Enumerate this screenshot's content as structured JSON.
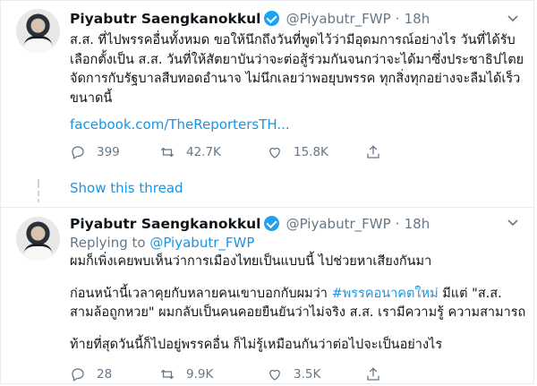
{
  "tweets": [
    {
      "name": "Piyabutr Saengkanokkul",
      "handle": "@Piyabutr_FWP",
      "dot": "·",
      "time": "18h",
      "lines": [
        "ส.ส. ที่ไปพรรคอื่นทั้งหมด ขอให้นึกถึงวันที่พูดไว้ว่ามีอุดมการณ์อย่างไร วันที่ได้รับ",
        "เลือกตั้งเป็น ส.ส. วันที่ให้สัตยาบันว่าจะต่อสู้ร่วมกันจนกว่าจะได้มาซึ่งประชาธิปไตย",
        "จัดการกับรัฐบาลสืบทอดอำนาจ ไม่นึกเลยว่าพอยุบพรรค ทุกสิ่งทุกอย่างจะลืมได้เร็ว",
        "ขนาดนี้"
      ],
      "link": "facebook.com/TheReportersTH...",
      "replies": "399",
      "retweets": "42.7K",
      "likes": "15.8K",
      "show_thread": "Show this thread"
    },
    {
      "name": "Piyabutr Saengkanokkul",
      "handle": "@Piyabutr_FWP",
      "dot": "·",
      "time": "18h",
      "replying_prefix": "Replying to ",
      "replying_handle": "@Piyabutr_FWP",
      "line1": "ผมก็เพิ่งเคยพบเห็นว่าการเมืองไทยเป็นแบบนี้ ไปช่วยหาเสียงกันมา",
      "line2_pre": "ก่อนหน้านี้เวลาคุยกับหลายคนเขาบอกกับผมว่า ",
      "line2_tag": "#พรรคอนาคตใหม่",
      "line2_post": " มีแต่ \"ส.ส.",
      "line3": "สามล้อถูกหวย\" ผมกลับเป็นคนคอยยืนยันว่าไม่จริง ส.ส. เรามีความรู้ ความสามารถ",
      "line4": "ท้ายที่สุดวันนี้ก็ไปอยู่พรรคอื่น ก็ไม่รู้เหมือนกันว่าต่อไปจะเป็นอย่างไร",
      "replies": "28",
      "retweets": "9.9K",
      "likes": "3.5K"
    }
  ],
  "colors": {
    "accent": "#1da1f2",
    "link": "#1b95e0",
    "muted": "#657786"
  }
}
